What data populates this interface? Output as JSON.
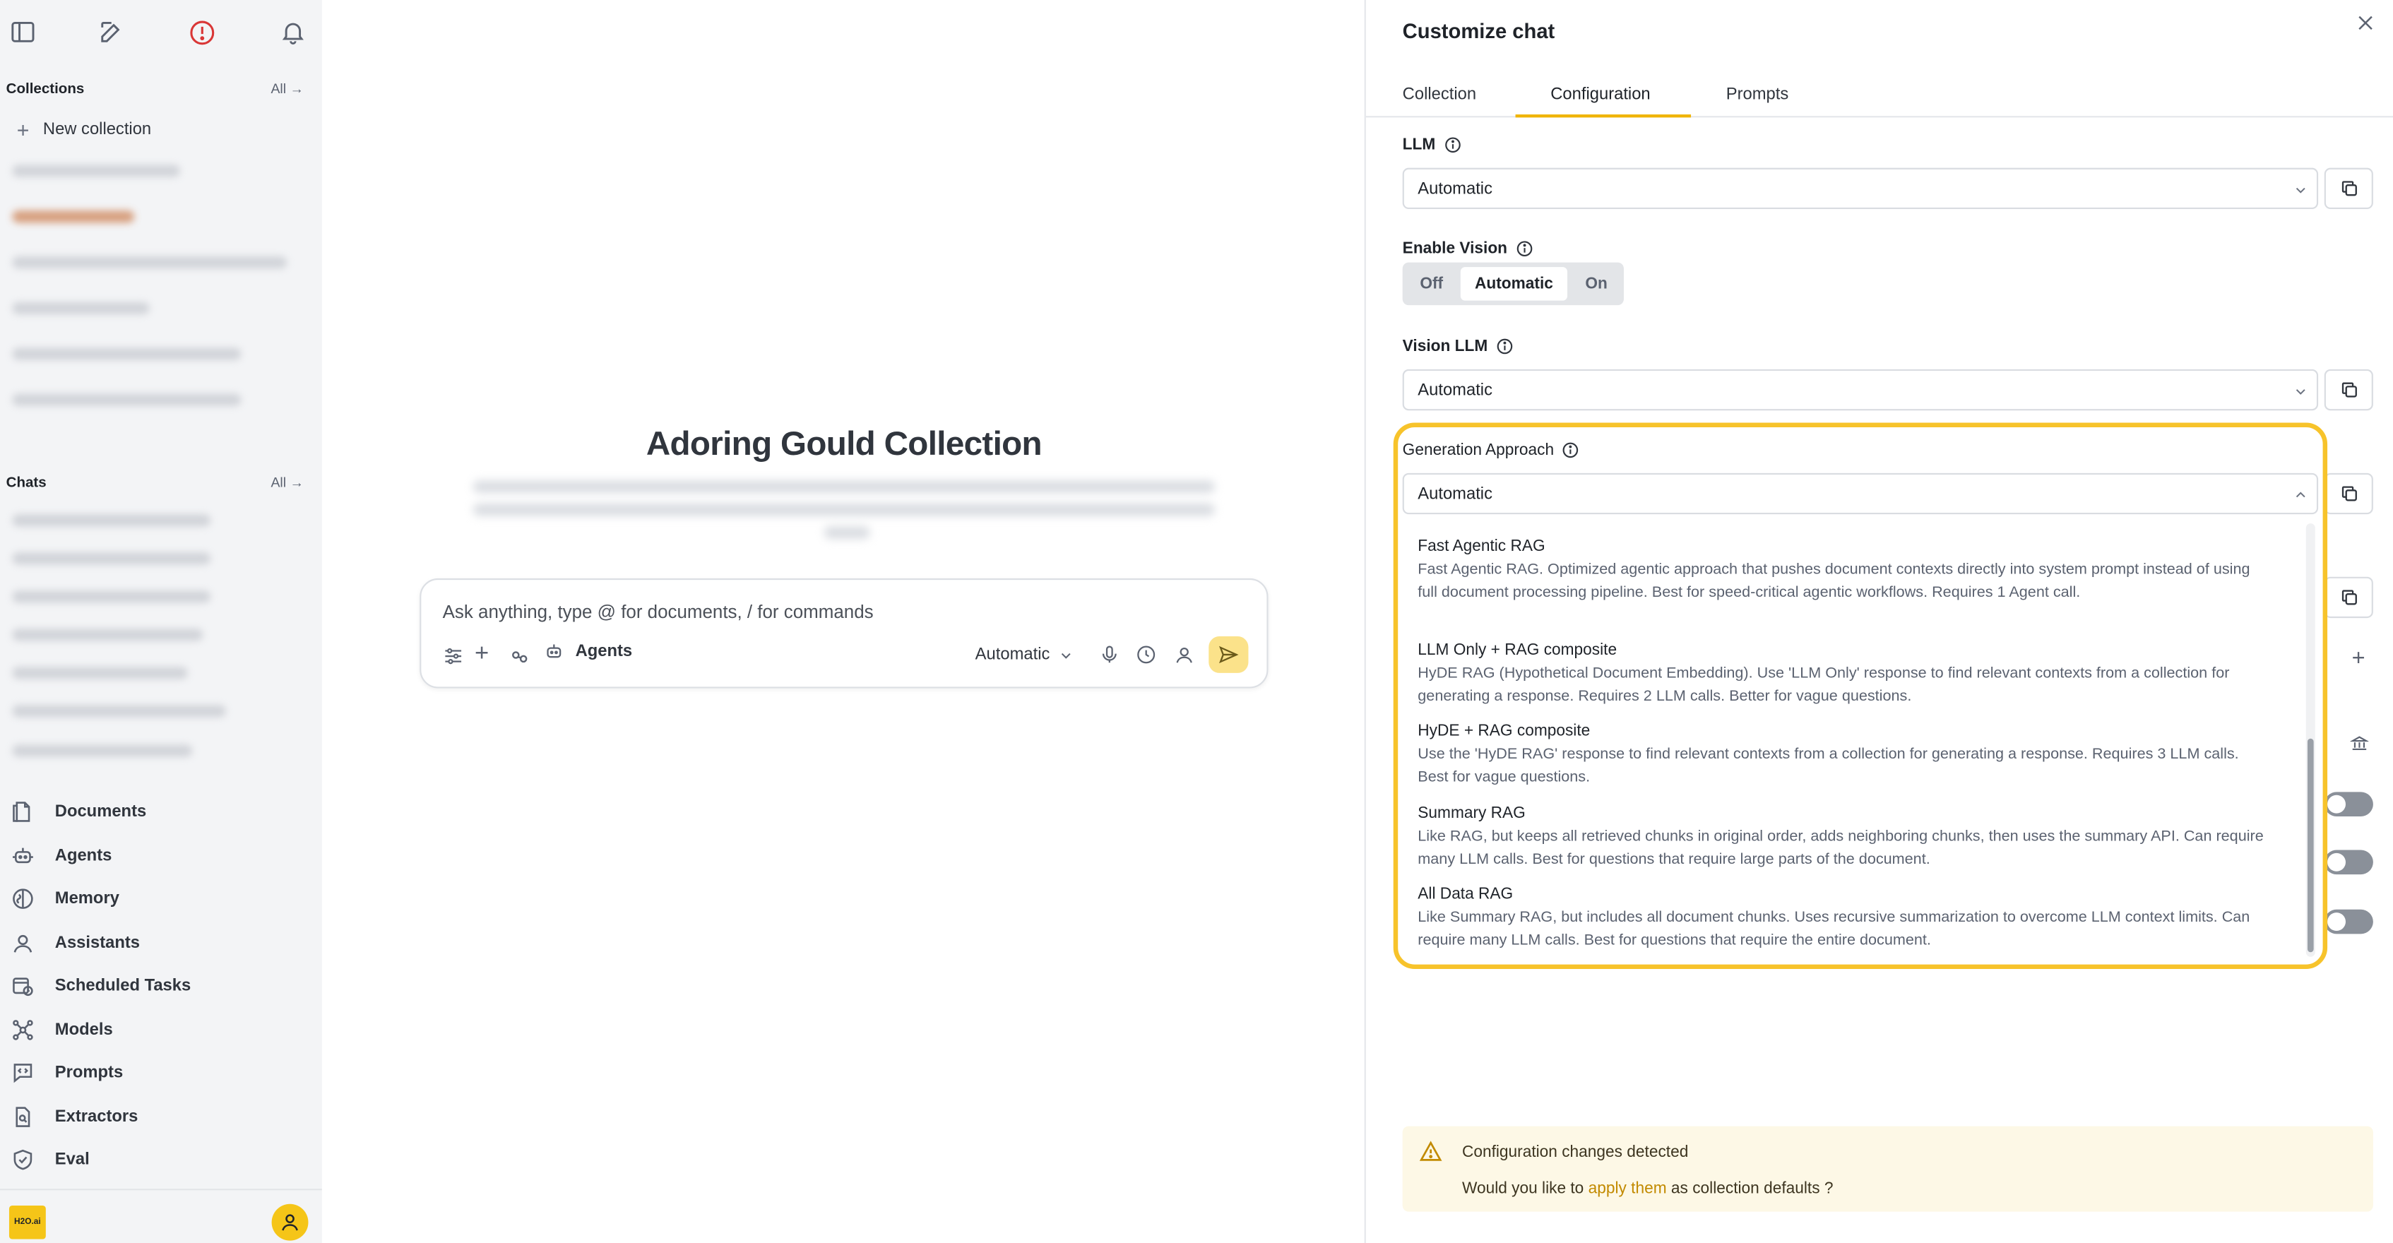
{
  "sidebar": {
    "top_icons": [
      "panel-toggle-icon",
      "compose-icon",
      "alert-icon",
      "bell-icon"
    ],
    "collections_title": "Collections",
    "collections_all": "All",
    "new_collection": "New collection",
    "chats_title": "Chats",
    "chats_all": "All",
    "nav": [
      {
        "label": "Documents",
        "icon": "document-icon"
      },
      {
        "label": "Agents",
        "icon": "agent-icon"
      },
      {
        "label": "Memory",
        "icon": "memory-icon"
      },
      {
        "label": "Assistants",
        "icon": "assistant-icon"
      },
      {
        "label": "Scheduled Tasks",
        "icon": "calendar-clock-icon"
      },
      {
        "label": "Models",
        "icon": "models-icon"
      },
      {
        "label": "Prompts",
        "icon": "prompt-icon"
      },
      {
        "label": "Extractors",
        "icon": "extractor-icon"
      },
      {
        "label": "Eval",
        "icon": "shield-check-icon"
      }
    ],
    "logo_text": "H2O.ai"
  },
  "main": {
    "title": "Adoring Gould Collection",
    "composer": {
      "placeholder": "Ask anything, type @ for documents, / for commands",
      "agents_label": "Agents",
      "model_label": "Automatic"
    }
  },
  "panel": {
    "title": "Customize chat",
    "tabs": [
      {
        "label": "Collection",
        "active": false
      },
      {
        "label": "Configuration",
        "active": true
      },
      {
        "label": "Prompts",
        "active": false
      }
    ],
    "llm": {
      "label": "LLM",
      "value": "Automatic"
    },
    "vision": {
      "label": "Enable Vision",
      "options": [
        "Off",
        "Automatic",
        "On"
      ],
      "selected": "Automatic"
    },
    "vision_llm": {
      "label": "Vision LLM",
      "value": "Automatic"
    },
    "generation": {
      "label": "Generation Approach",
      "value": "Automatic",
      "options": [
        {
          "title": "Fast Agentic RAG",
          "desc": "Fast Agentic RAG. Optimized agentic approach that pushes document contexts directly into system prompt instead of using full document processing pipeline. Best for speed-critical agentic workflows. Requires 1 Agent call."
        },
        {
          "title": "LLM Only + RAG composite",
          "desc": "HyDE RAG (Hypothetical Document Embedding). Use 'LLM Only' response to find relevant contexts from a collection for generating a response. Requires 2 LLM calls. Better for vague questions."
        },
        {
          "title": "HyDE + RAG composite",
          "desc": "Use the 'HyDE RAG' response to find relevant contexts from a collection for generating a response. Requires 3 LLM calls. Best for vague questions."
        },
        {
          "title": "Summary RAG",
          "desc": "Like RAG, but keeps all retrieved chunks in original order, adds neighboring chunks, then uses the summary API. Can require many LLM calls. Best for questions that require large parts of the document."
        },
        {
          "title": "All Data RAG",
          "desc": "Like Summary RAG, but includes all document chunks. Uses recursive summarization to overcome LLM context limits. Can require many LLM calls. Best for questions that require the entire document."
        }
      ]
    },
    "notice": {
      "title": "Configuration changes detected",
      "text_before": "Would you like to",
      "link": "apply them",
      "text_after": "as collection defaults ?"
    }
  },
  "colors": {
    "accent": "#f5c518",
    "highlight_border": "#f7c32b",
    "tab_underline": "#f0b400",
    "notice_bg": "#fdf8e6",
    "link": "#c28a00"
  }
}
